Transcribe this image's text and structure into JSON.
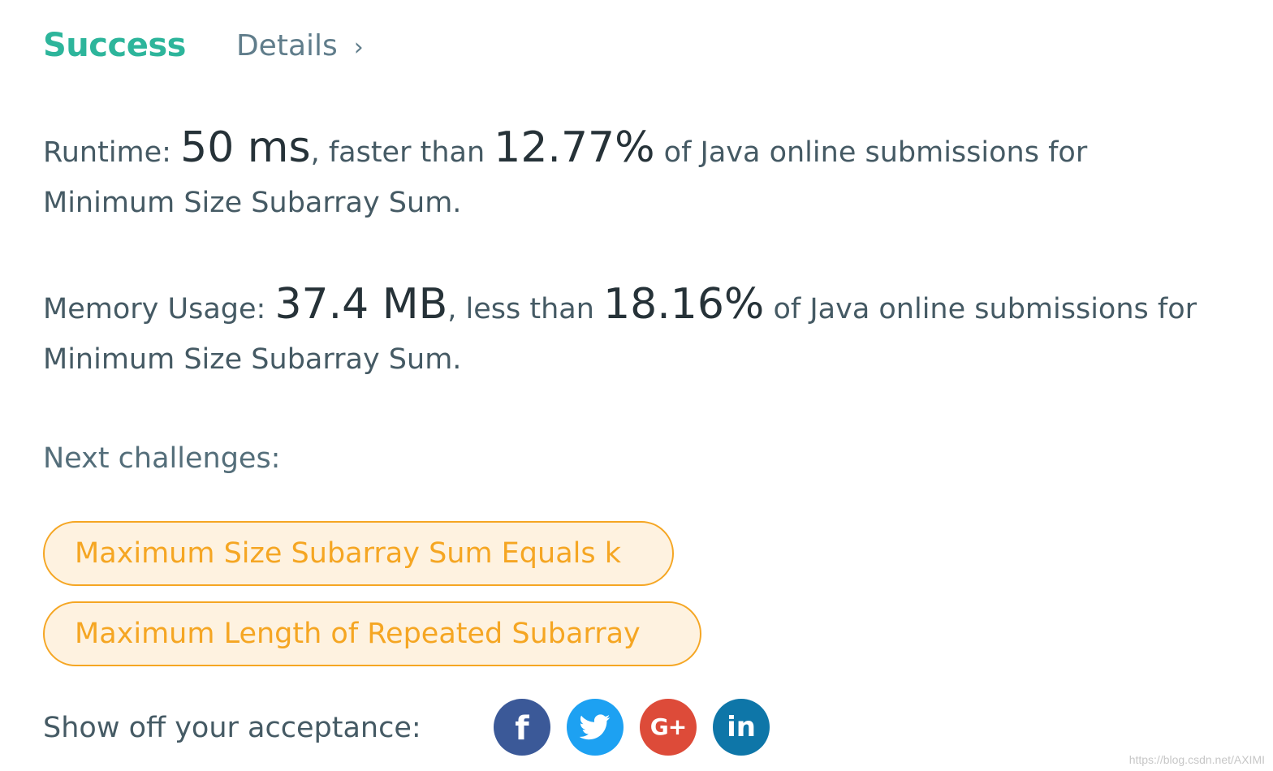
{
  "header": {
    "status": "Success",
    "details_label": "Details",
    "chevron_glyph": "›"
  },
  "runtime": {
    "label": "Runtime: ",
    "value": "50 ms",
    "comparison": ", faster than ",
    "percent": "12.77%",
    "suffix": " of Java online submissions for",
    "problem": "Minimum Size Subarray Sum."
  },
  "memory": {
    "label": "Memory Usage: ",
    "value": "37.4 MB",
    "comparison": ", less than ",
    "percent": "18.16%",
    "suffix": " of Java online submissions for",
    "problem": "Minimum Size Subarray Sum."
  },
  "next": {
    "label": "Next challenges:",
    "challenges": [
      {
        "label": "Maximum Size Subarray Sum Equals k"
      },
      {
        "label": "Maximum Length of Repeated Subarray"
      }
    ]
  },
  "share": {
    "label": "Show off your acceptance:",
    "buttons": [
      {
        "icon": "facebook-icon",
        "glyph": "f",
        "color": "#3b5998"
      },
      {
        "icon": "twitter-icon",
        "color": "#1da1f2"
      },
      {
        "icon": "google-plus-icon",
        "glyph": "G+",
        "color": "#dd4b39"
      },
      {
        "icon": "linkedin-icon",
        "glyph": "in",
        "color": "#0e76a8"
      }
    ]
  },
  "colors": {
    "success": "#2db59b",
    "challenge_accent": "#f5a623",
    "challenge_bg": "#fef2e0"
  },
  "watermark": "https://blog.csdn.net/AXIMI"
}
